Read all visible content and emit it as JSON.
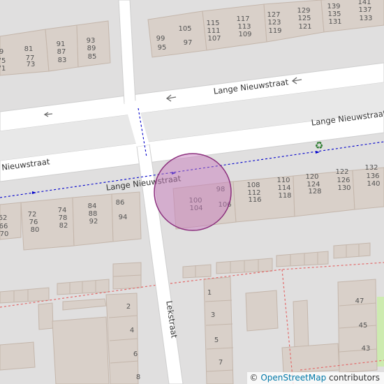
{
  "map": {
    "streets": {
      "main": "Lange Nieuwstraat",
      "side": "Lekstraat"
    },
    "house_numbers": {
      "top_left": [
        "9",
        "75",
        "71",
        "81",
        "77",
        "73",
        "91",
        "87",
        "83",
        "93",
        "89",
        "85"
      ],
      "top_middle": [
        "105",
        "99",
        "95",
        "97",
        "115",
        "111",
        "107",
        "117",
        "113",
        "109",
        "127",
        "123",
        "119",
        "129",
        "125",
        "121"
      ],
      "top_right": [
        "139",
        "135",
        "131",
        "141",
        "137",
        "133"
      ],
      "mid_left": [
        "62",
        "66",
        "70",
        "72",
        "76",
        "80",
        "74",
        "78",
        "82",
        "84",
        "88",
        "92",
        "86",
        "94"
      ],
      "mid_right": [
        "98",
        "100",
        "104",
        "106",
        "108",
        "112",
        "116",
        "110",
        "114",
        "118",
        "120",
        "124",
        "128",
        "122",
        "126",
        "130",
        "132",
        "136",
        "140"
      ],
      "bottom_left": [
        "2",
        "4",
        "6",
        "8"
      ],
      "bottom_right": [
        "1",
        "3",
        "5",
        "7",
        "47",
        "45",
        "43"
      ]
    },
    "recycling_icon": "recycling-icon",
    "colors": {
      "background": "#e0dfdf",
      "building": "#d9d0c9",
      "building_stroke": "#c4b6ab",
      "road": "#ffffff",
      "marker_fill": "#c87dbd",
      "marker_stroke": "#8b2f7d",
      "route": "#0000cc",
      "boundary": "#e26a6a",
      "green": "#cdebb0"
    }
  },
  "attribution": {
    "symbol": "©",
    "link": "OpenStreetMap",
    "text": "contributors"
  }
}
